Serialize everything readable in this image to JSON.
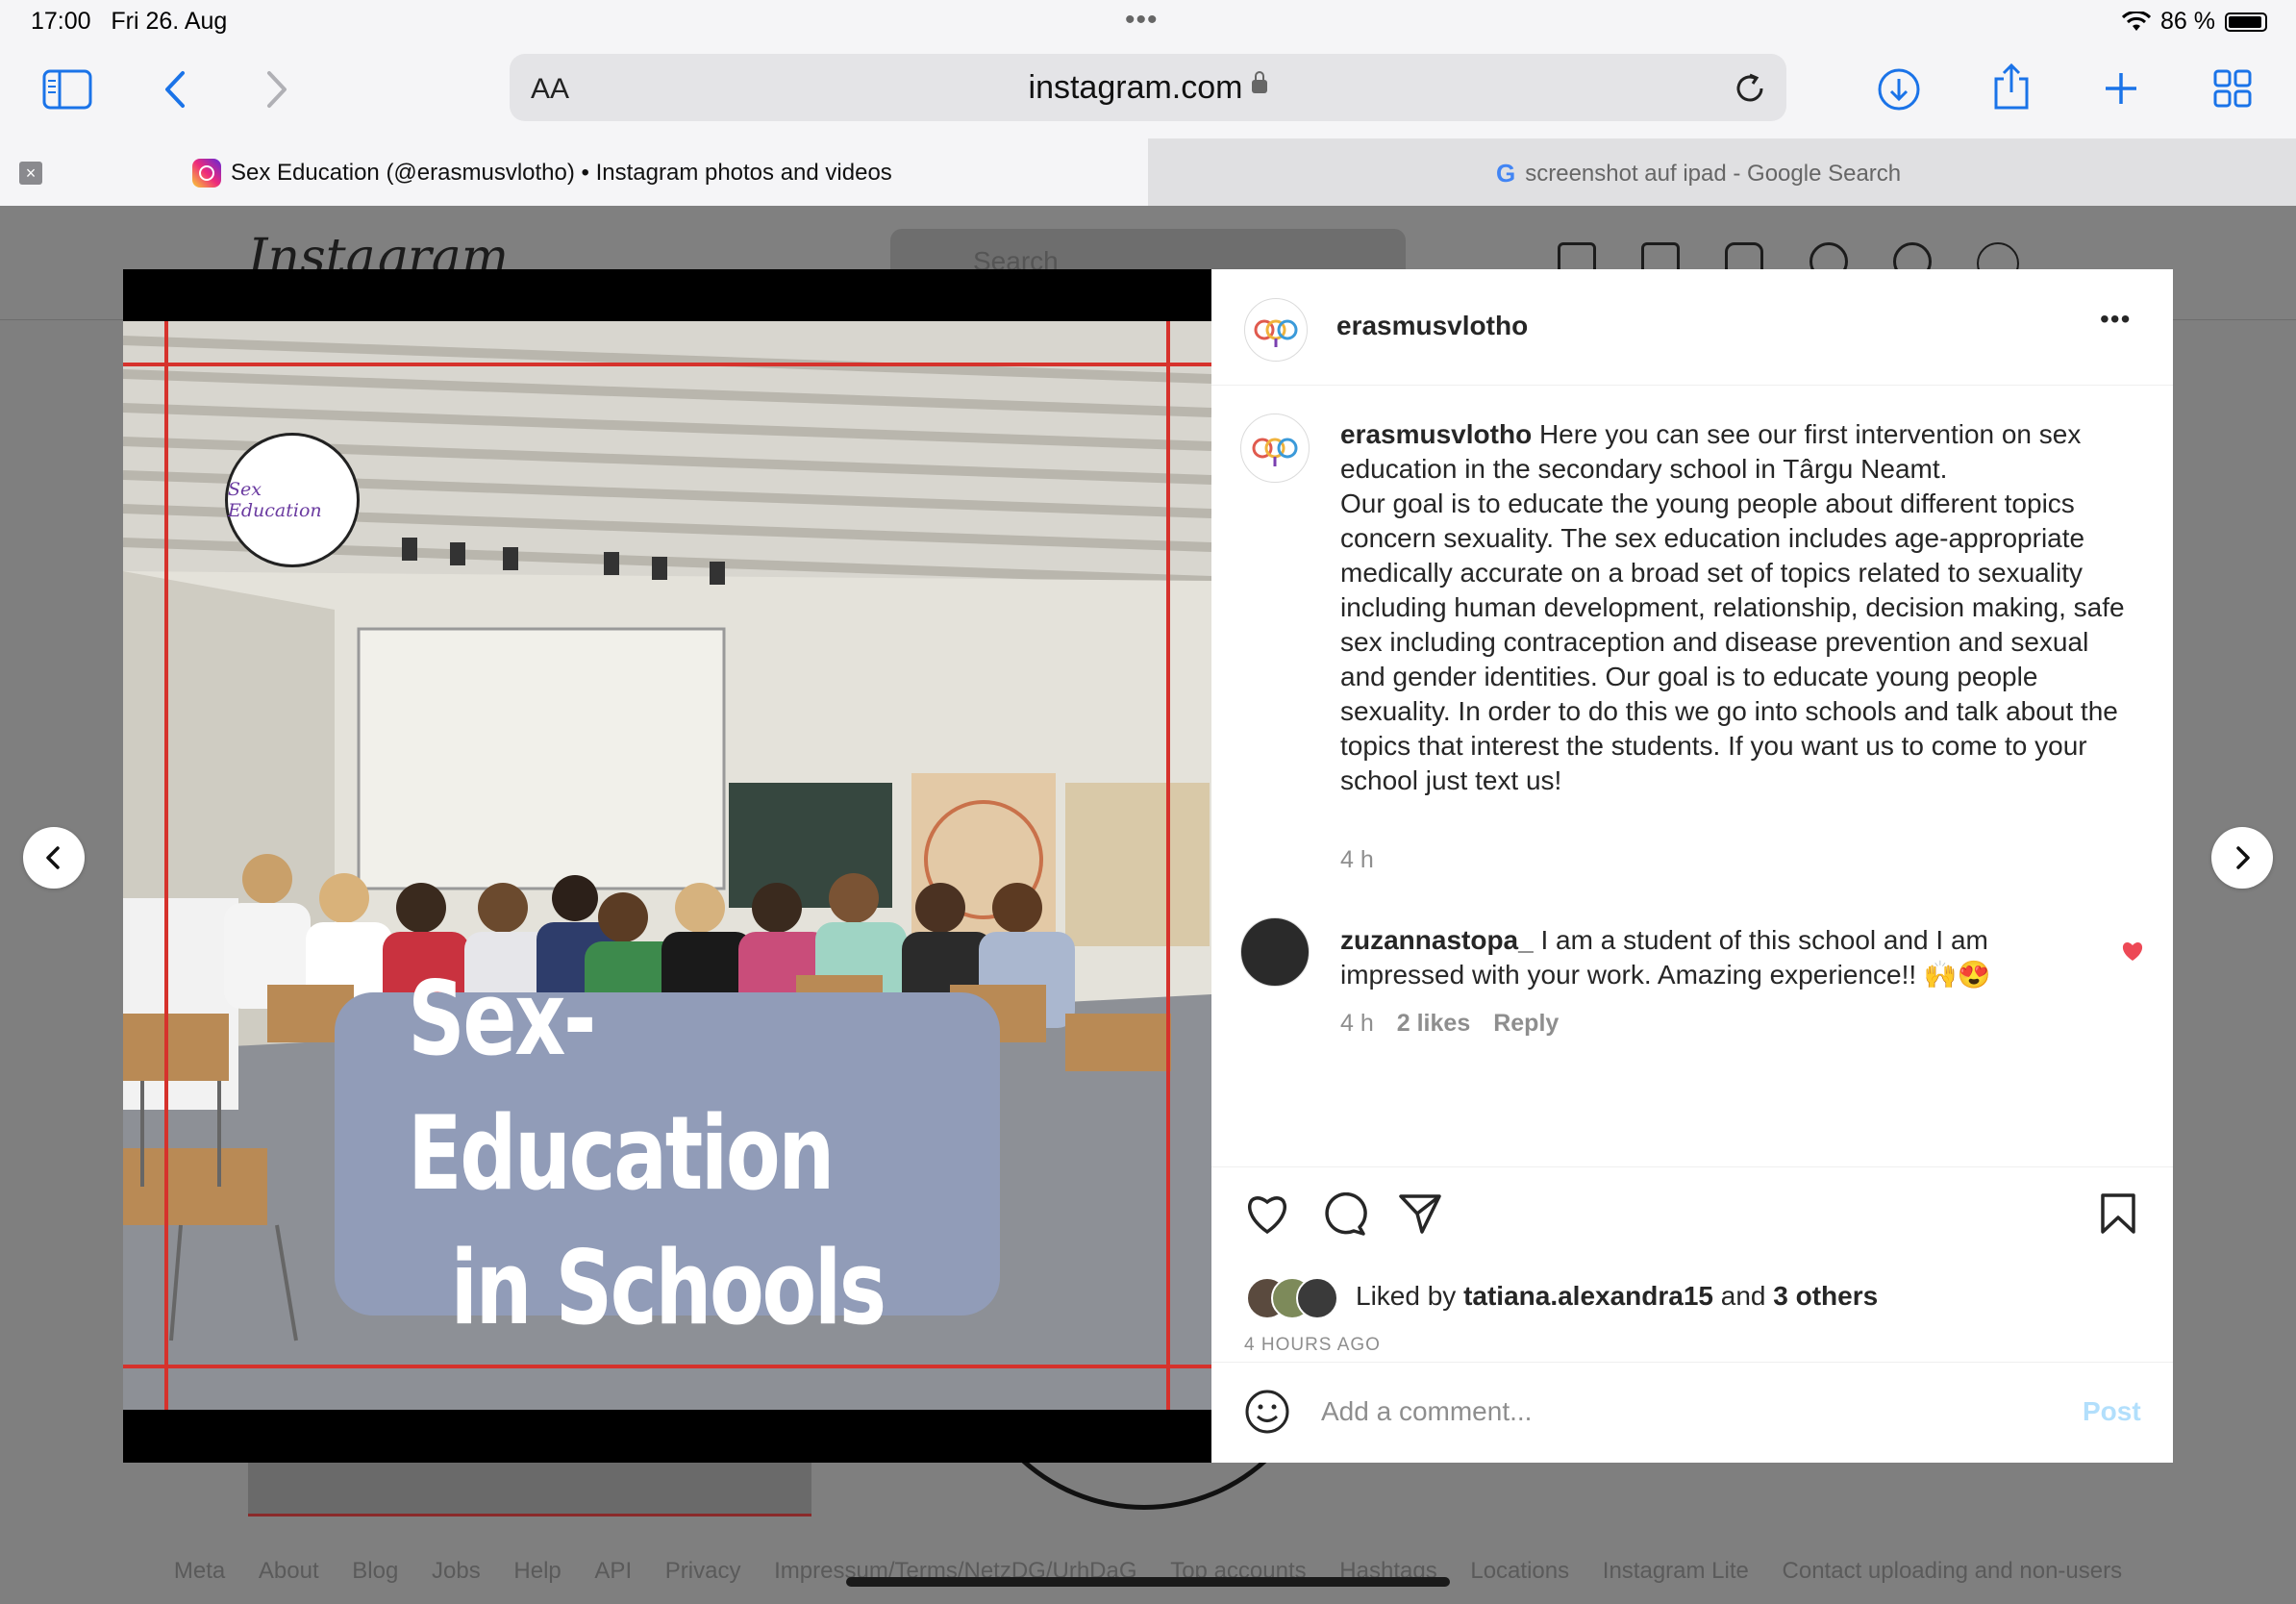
{
  "status": {
    "time": "17:00",
    "date": "Fri 26. Aug",
    "dots": "•••",
    "battery": "86 %",
    "battery_level": 0.86
  },
  "toolbar": {
    "aa": "AA",
    "url": "instagram.com",
    "icons": [
      "sidebar-icon",
      "back-icon",
      "forward-icon",
      "reload-icon",
      "download-icon",
      "share-icon",
      "new-tab-icon",
      "tabs-overview-icon"
    ]
  },
  "tabs": [
    {
      "title": "Sex Education (@erasmusvlotho) • Instagram photos and videos",
      "active": true
    },
    {
      "title": "screenshot auf ipad - Google Search",
      "active": false
    }
  ],
  "background_page": {
    "logo": "Instagram",
    "search_placeholder": "Search",
    "footer_links": [
      "Meta",
      "About",
      "Blog",
      "Jobs",
      "Help",
      "API",
      "Privacy",
      "Impressum/Terms/NetzDG/UrhDaG",
      "Top accounts",
      "Hashtags",
      "Locations",
      "Instagram Lite",
      "Contact uploading and non-users"
    ]
  },
  "post": {
    "image_title_line1": "Sex-Education",
    "image_title_line2": "in Schools",
    "logo_text": "Sex Education",
    "author": "erasmusvlotho",
    "more": "•••",
    "caption_user": "erasmusvlotho",
    "caption": "Here you can see our first intervention on sex education in the secondary school in Târgu Neamt.\nOur goal is to educate the young people about different topics concern sexuality. The sex education includes age-appropriate medically accurate on a broad set of topics related to sexuality including human development, relationship, decision making, safe sex including contraception and disease prevention and sexual and gender identities. Our goal is to educate young people sexuality. In order to do this we go into schools and talk about the topics that interest the students. If you want us to come to your school just text us!",
    "caption_time": "4 h",
    "comment": {
      "user": "zuzannastopa_",
      "text": "I am a student of this school and I am impressed with your work. Amazing experience!! 🙌😍",
      "time": "4 h",
      "likes": "2 likes",
      "reply": "Reply"
    },
    "liked_prefix": "Liked by",
    "liked_user": "tatiana.alexandra15",
    "liked_and": "and",
    "liked_others": "3 others",
    "post_time": "4 HOURS AGO",
    "comment_placeholder": "Add a comment...",
    "post_button": "Post"
  },
  "colors": {
    "accent": "#1a73e8",
    "heart": "#ed4956",
    "post_disabled": "#b2dffc",
    "image_box": "#919cb8"
  }
}
